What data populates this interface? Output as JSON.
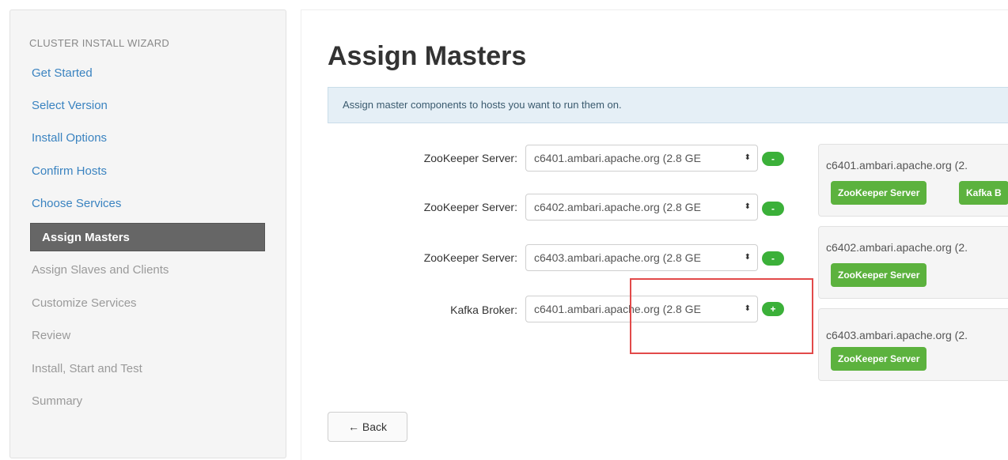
{
  "sidebar": {
    "header": "CLUSTER INSTALL WIZARD",
    "items": [
      {
        "label": "Get Started",
        "state": "link"
      },
      {
        "label": "Select Version",
        "state": "link"
      },
      {
        "label": "Install Options",
        "state": "link"
      },
      {
        "label": "Confirm Hosts",
        "state": "link"
      },
      {
        "label": "Choose Services",
        "state": "link"
      },
      {
        "label": "Assign Masters",
        "state": "active"
      },
      {
        "label": "Assign Slaves and Clients",
        "state": "disabled"
      },
      {
        "label": "Customize Services",
        "state": "disabled"
      },
      {
        "label": "Review",
        "state": "disabled"
      },
      {
        "label": "Install, Start and Test",
        "state": "disabled"
      },
      {
        "label": "Summary",
        "state": "disabled"
      }
    ]
  },
  "main": {
    "title": "Assign Masters",
    "alert": "Assign master components to hosts you want to run them on.",
    "assignments": [
      {
        "label": "ZooKeeper Server:",
        "value": "c6401.ambari.apache.org (2.8 GE",
        "button": "-"
      },
      {
        "label": "ZooKeeper Server:",
        "value": "c6402.ambari.apache.org (2.8 GE",
        "button": "-"
      },
      {
        "label": "ZooKeeper Server:",
        "value": "c6403.ambari.apache.org (2.8 GE",
        "button": "-"
      },
      {
        "label": "Kafka Broker:",
        "value": "c6401.ambari.apache.org (2.8 GE",
        "button": "+"
      }
    ],
    "hosts": [
      {
        "name": "c6401.ambari.apache.org (2.",
        "tags": [
          "ZooKeeper Server",
          "Kafka B"
        ]
      },
      {
        "name": "c6402.ambari.apache.org (2.",
        "tags": [
          "ZooKeeper Server"
        ]
      },
      {
        "name": "c6403.ambari.apache.org (2.",
        "tags": [
          "ZooKeeper Server"
        ]
      }
    ],
    "back_label": "← Back",
    "select_arrow": "⬍"
  },
  "colors": {
    "accent_link": "#3a83c0",
    "active_nav": "#666666",
    "green": "#3bb039",
    "highlight": "#e24a4a"
  }
}
